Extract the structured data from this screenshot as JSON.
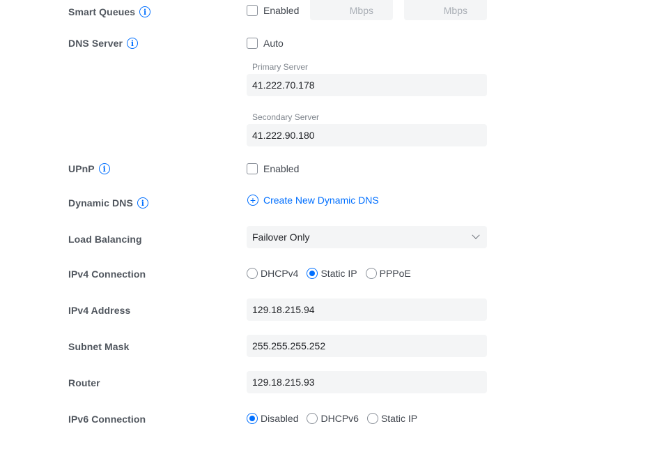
{
  "smart_queues": {
    "label": "Smart Queues",
    "checkbox_label": "Enabled",
    "checked": false,
    "download_unit": "Mbps",
    "upload_unit": "Mbps"
  },
  "dns_server": {
    "label": "DNS Server",
    "checkbox_label": "Auto",
    "checked": false,
    "primary_label": "Primary Server",
    "primary_value": "41.222.70.178",
    "secondary_label": "Secondary Server",
    "secondary_value": "41.222.90.180"
  },
  "upnp": {
    "label": "UPnP",
    "checkbox_label": "Enabled",
    "checked": false
  },
  "dynamic_dns": {
    "label": "Dynamic DNS",
    "link_label": "Create New Dynamic DNS"
  },
  "load_balancing": {
    "label": "Load Balancing",
    "selected": "Failover Only"
  },
  "ipv4_connection": {
    "label": "IPv4 Connection",
    "options": [
      "DHCPv4",
      "Static IP",
      "PPPoE"
    ],
    "selected": "Static IP"
  },
  "ipv4_address": {
    "label": "IPv4 Address",
    "value": "129.18.215.94"
  },
  "subnet_mask": {
    "label": "Subnet Mask",
    "value": "255.255.255.252"
  },
  "router": {
    "label": "Router",
    "value": "129.18.215.93"
  },
  "ipv6_connection": {
    "label": "IPv6 Connection",
    "options": [
      "Disabled",
      "DHCPv6",
      "Static IP"
    ],
    "selected": "Disabled"
  },
  "colors": {
    "accent": "#006fff",
    "field_bg": "#f4f5f6",
    "label": "#50565e"
  }
}
